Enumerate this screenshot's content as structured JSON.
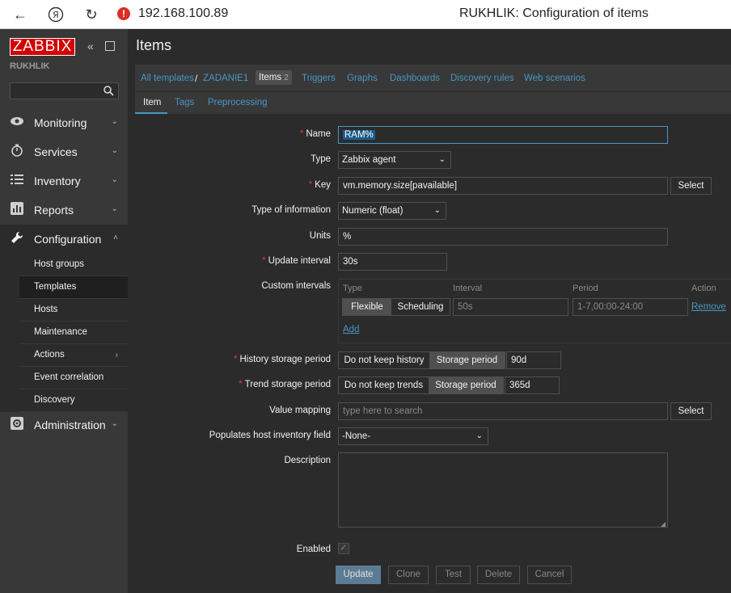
{
  "browser": {
    "url": "192.168.100.89",
    "page_title": "RUKHLIK: Configuration of items"
  },
  "sidebar": {
    "logo": "ZABBIX",
    "instance": "RUKHLIK",
    "search_placeholder": "",
    "menu": [
      {
        "label": "Monitoring",
        "icon": "eye-icon"
      },
      {
        "label": "Services",
        "icon": "stopwatch-icon"
      },
      {
        "label": "Inventory",
        "icon": "list-icon"
      },
      {
        "label": "Reports",
        "icon": "bar-chart-icon"
      },
      {
        "label": "Configuration",
        "icon": "wrench-icon"
      },
      {
        "label": "Administration",
        "icon": "gear-icon"
      }
    ],
    "submenu": [
      {
        "label": "Host groups"
      },
      {
        "label": "Templates"
      },
      {
        "label": "Hosts"
      },
      {
        "label": "Maintenance"
      },
      {
        "label": "Actions"
      },
      {
        "label": "Event correlation"
      },
      {
        "label": "Discovery"
      }
    ]
  },
  "header": {
    "title": "Items"
  },
  "nav": {
    "all_templates": "All templates",
    "separator": "/",
    "template": "ZADANIE1",
    "items": "Items",
    "items_count": "2",
    "triggers": "Triggers",
    "graphs": "Graphs",
    "dashboards": "Dashboards",
    "discovery_rules": "Discovery rules",
    "web_scenarios": "Web scenarios"
  },
  "tabs": [
    "Item",
    "Tags",
    "Preprocessing"
  ],
  "form": {
    "name_label": "Name",
    "name_value": "RAM%",
    "type_label": "Type",
    "type_value": "Zabbix agent",
    "key_label": "Key",
    "key_value": "vm.memory.size[pavailable]",
    "key_select": "Select",
    "type_info_label": "Type of information",
    "type_info_value": "Numeric (float)",
    "units_label": "Units",
    "units_value": "%",
    "update_interval_label": "Update interval",
    "update_interval_value": "30s",
    "custom_intervals_label": "Custom intervals",
    "ci_headers": {
      "type": "Type",
      "interval": "Interval",
      "period": "Period",
      "action": "Action"
    },
    "ci_row": {
      "flexible": "Flexible",
      "scheduling": "Scheduling",
      "interval": "50s",
      "period": "1-7,00:00-24:00",
      "remove": "Remove"
    },
    "ci_add": "Add",
    "history_label": "History storage period",
    "history_options": [
      "Do not keep history",
      "Storage period"
    ],
    "history_value": "90d",
    "trend_label": "Trend storage period",
    "trend_options": [
      "Do not keep trends",
      "Storage period"
    ],
    "trend_value": "365d",
    "value_mapping_label": "Value mapping",
    "value_mapping_placeholder": "type here to search",
    "value_mapping_select": "Select",
    "inventory_label": "Populates host inventory field",
    "inventory_value": "-None-",
    "description_label": "Description",
    "enabled_label": "Enabled",
    "enabled_mark": "✓"
  },
  "buttons": {
    "update": "Update",
    "clone": "Clone",
    "test": "Test",
    "delete": "Delete",
    "cancel": "Cancel"
  }
}
